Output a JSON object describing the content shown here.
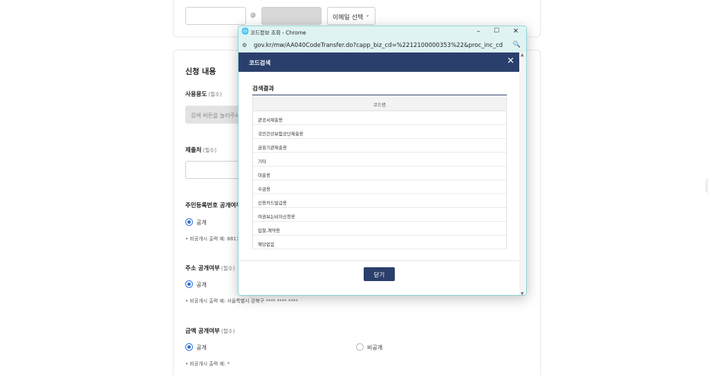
{
  "background": {
    "email": {
      "at": "@",
      "select_label": "이메일 선택"
    },
    "section_title": "신청 내용",
    "fields": [
      {
        "label": "사용용도",
        "req": "(필수)"
      },
      {
        "label": "제출처",
        "req": "(필수)"
      },
      {
        "label": "주민등록번호 공개여부",
        "req": ""
      },
      {
        "label": "주소 공개여부",
        "req": "(필수)"
      },
      {
        "label": "금액 공개여부",
        "req": "(필수)"
      }
    ],
    "search_placeholder": "검색 버튼을 눌러주세요",
    "radio_public": "공개",
    "radio_private": "비공개",
    "hints": [
      "• 비공개시 출력 예: 8811",
      "• 비공개시 출력 예: 서울특별시 강북구 **** **** ****",
      "• 비공개시 출력 예: *"
    ]
  },
  "popup": {
    "window_title": "코드정보 조회 - Chrome",
    "url": "gov.kr/mw/AA040CodeTransfer.do?capp_biz_cd=%2212100000353%22&proc_inc_cd=%22...",
    "modal_title": "코드검색",
    "result_title": "검색결과",
    "column_header": "코드명",
    "rows": [
      "관공서제출용",
      "국민건강보험공단제출용",
      "금융기관제출용",
      "기타",
      "대출용",
      "수금용",
      "신용카드발급용",
      "여권보는비자신청용",
      "입찰,계약용",
      "해당없음"
    ],
    "close_label": "닫기"
  },
  "colors": {
    "modal_header": "#2b3f6c",
    "accent": "#2f6fd6",
    "titlebar": "#dff3f3"
  }
}
